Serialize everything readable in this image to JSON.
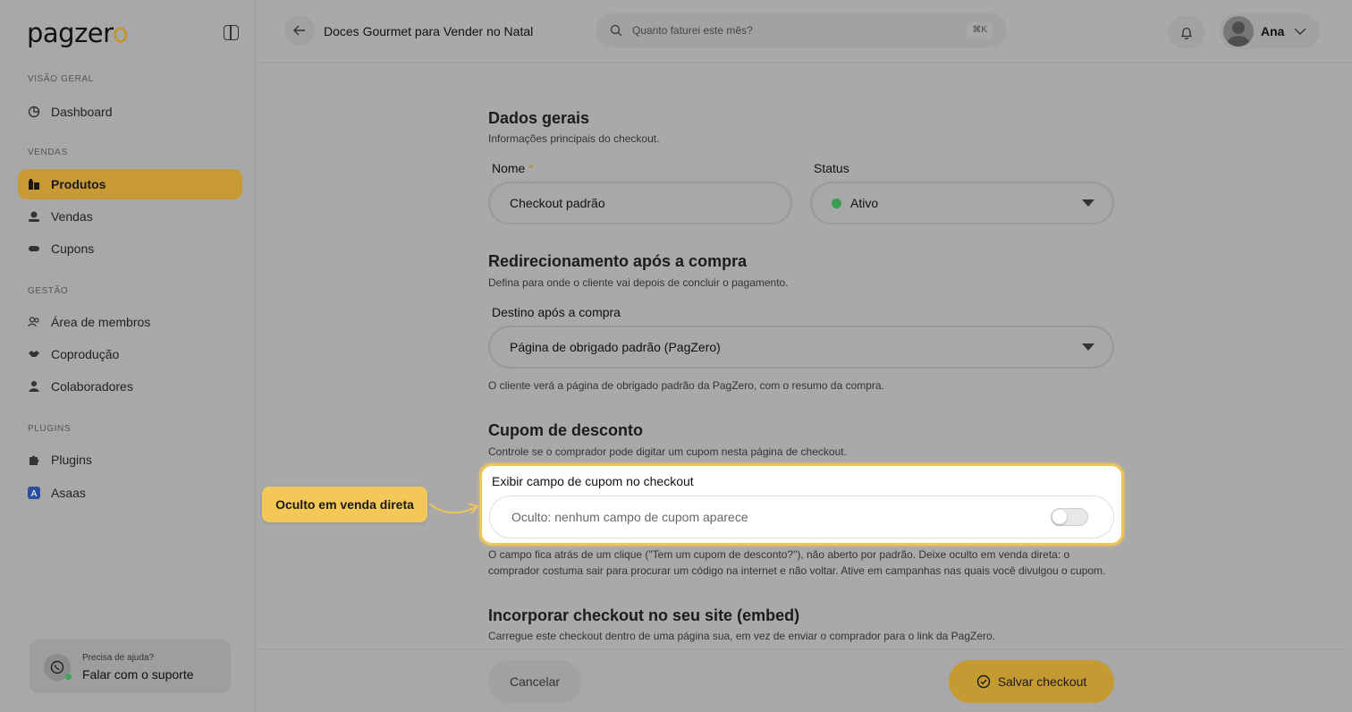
{
  "sidebar": {
    "logo": "pagzer",
    "logo_accent": "o",
    "sections": [
      {
        "title": "VISÃO GERAL"
      },
      {
        "title": "VENDAS"
      },
      {
        "title": "GESTÃO"
      },
      {
        "title": "PLUGINS"
      }
    ],
    "items": [
      {
        "label": "Dashboard",
        "icon": "dashboard-icon"
      },
      {
        "label": "Produtos",
        "icon": "products-icon",
        "active": true
      },
      {
        "label": "Vendas",
        "icon": "sales-icon"
      },
      {
        "label": "Cupons",
        "icon": "coupon-icon"
      },
      {
        "label": "Área de membros",
        "icon": "members-icon"
      },
      {
        "label": "Coprodução",
        "icon": "handshake-icon"
      },
      {
        "label": "Colaboradores",
        "icon": "collaborators-icon"
      },
      {
        "label": "Plugins",
        "icon": "puzzle-icon"
      },
      {
        "label": "Asaas",
        "icon": "asaas-icon"
      }
    ],
    "support": {
      "small": "Precisa de ajuda?",
      "big": "Falar com o suporte"
    }
  },
  "header": {
    "title": "Doces Gourmet para Vender no Natal",
    "search_placeholder": "Quanto faturei este mês?",
    "search_shortcut": "⌘K",
    "user_name": "Ana"
  },
  "general": {
    "title": "Dados gerais",
    "subtitle": "Informações principais do checkout.",
    "name_label": "Nome",
    "name_required": "*",
    "name_value": "Checkout padrão",
    "status_label": "Status",
    "status_value": "Ativo"
  },
  "redirect": {
    "title": "Redirecionamento após a compra",
    "subtitle": "Defina para onde o cliente vai depois de concluir o pagamento.",
    "dest_label": "Destino após a compra",
    "dest_value": "Página de obrigado padrão (PagZero)",
    "note": "O cliente verá a página de obrigado padrão da PagZero, com o resumo da compra."
  },
  "coupon": {
    "title": "Cupom de desconto",
    "subtitle": "Controle se o comprador pode digitar um cupom nesta página de checkout.",
    "field_label": "Exibir campo de cupom no checkout",
    "field_value": "Oculto: nenhum campo de cupom aparece",
    "toggle_on": false,
    "note_line1": "O campo fica atrás de um clique (\"Tem um cupom de desconto?\"), não aberto por padrão. Deixe oculto em venda direta: o",
    "note_line2": "comprador costuma sair para procurar um código na internet e não voltar. Ative em campanhas nas quais você divulgou o cupom.",
    "callout": "Oculto em venda direta"
  },
  "embed": {
    "title": "Incorporar checkout no seu site (embed)",
    "subtitle": "Carregue este checkout dentro de uma página sua, em vez de enviar o comprador para o link da PagZero."
  },
  "footer": {
    "cancel": "Cancelar",
    "save": "Salvar checkout"
  },
  "colors": {
    "accent": "#c89a35",
    "highlight_border": "#eec55b",
    "callout_bg": "#f3c858",
    "status_green": "#3d9a51"
  }
}
